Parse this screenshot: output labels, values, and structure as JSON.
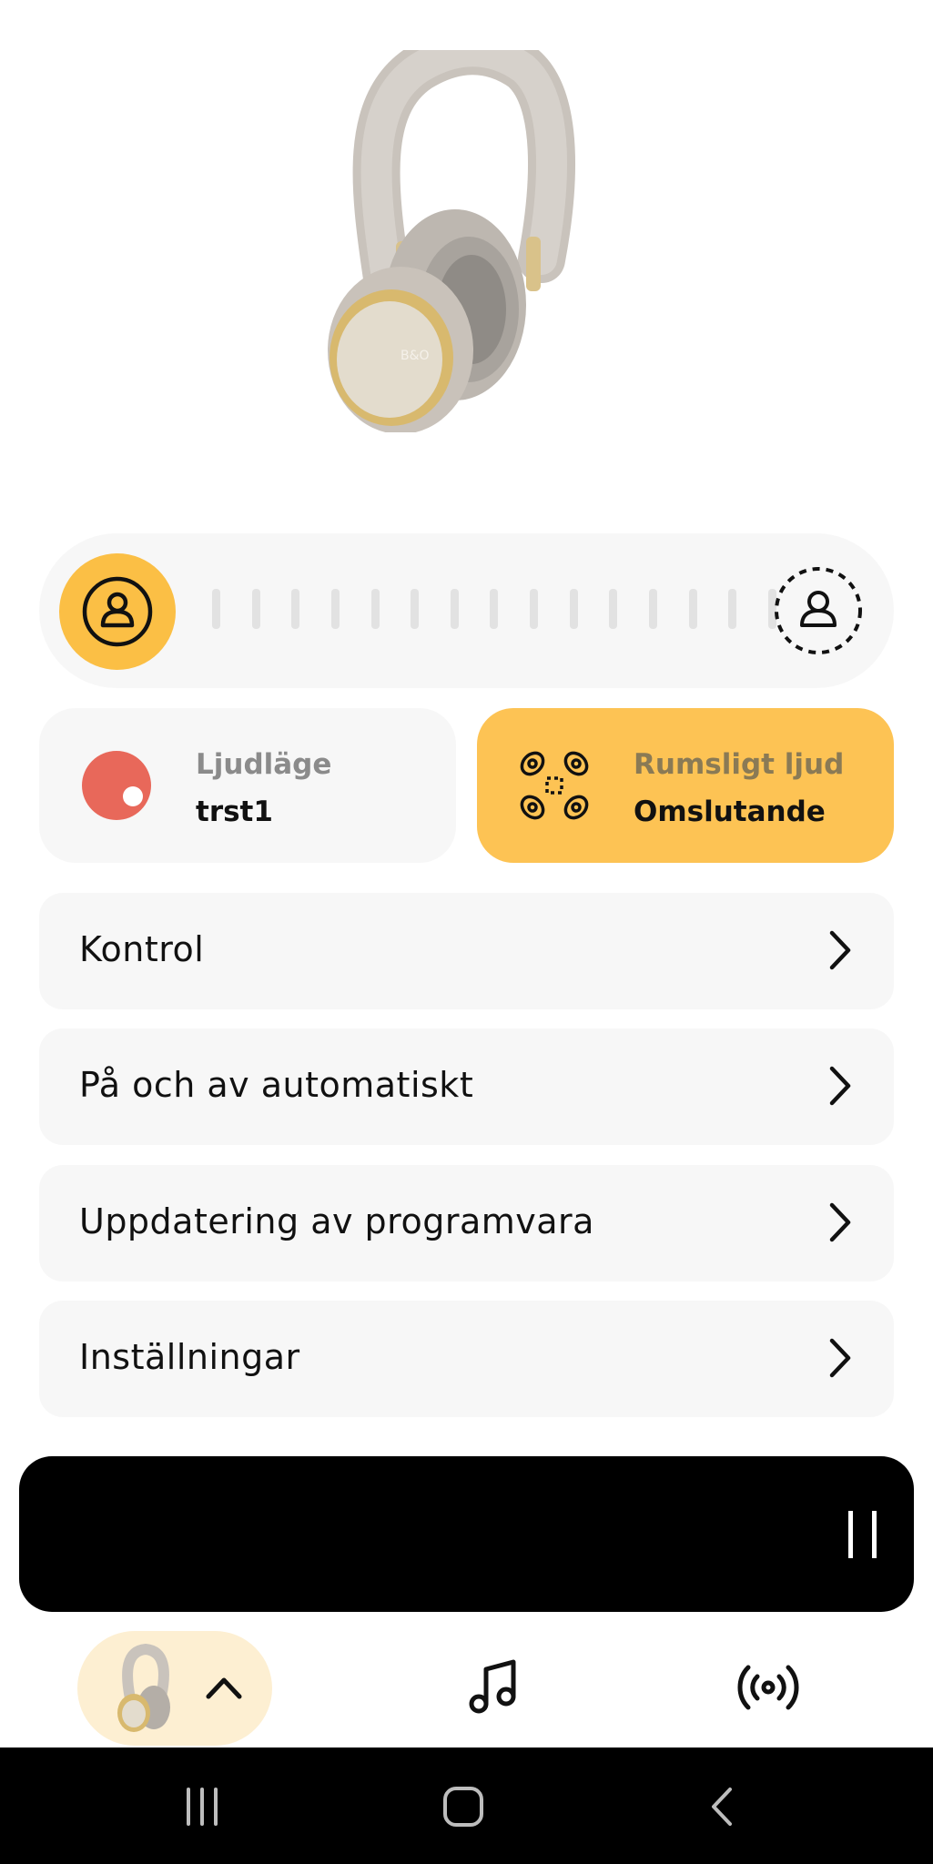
{
  "device": {
    "name": "headphones",
    "logo_text": "B&O"
  },
  "transparency": {
    "left_icon": "person-icon",
    "right_icon": "person-dashed-icon",
    "level": 0.0
  },
  "cards": {
    "sound_mode": {
      "label": "Ljudläge",
      "value": "trst1",
      "icon": "sound-mode-dot-icon",
      "color": "#e8685a"
    },
    "spatial": {
      "label": "Rumsligt ljud",
      "value": "Omslutande",
      "icon": "spatial-speakers-icon"
    }
  },
  "menu": [
    {
      "label": "Kontrol"
    },
    {
      "label": "På och av automatiskt"
    },
    {
      "label": "Uppdatering av programvara"
    },
    {
      "label": "Inställningar"
    }
  ],
  "player": {
    "control": "pause-icon"
  },
  "bottom_nav": {
    "device": "headphones-thumb",
    "music": "music-note-icon",
    "radio": "broadcast-icon"
  },
  "colors": {
    "accent": "#fdc354",
    "accent_strong": "#fbbf45",
    "card_bg": "#f7f7f7",
    "nav_active_bg": "#fdefd2"
  }
}
